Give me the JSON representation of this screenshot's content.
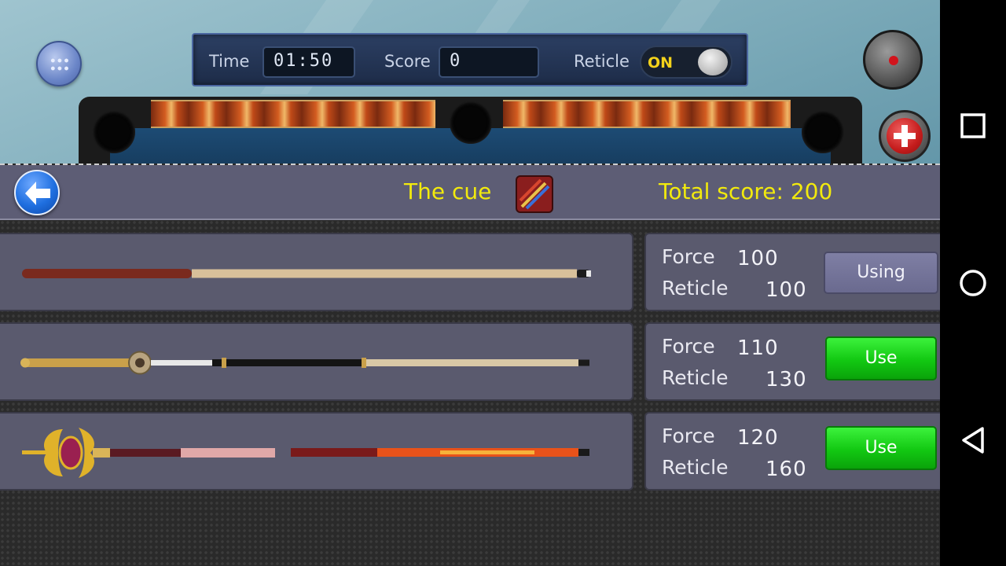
{
  "hud": {
    "time_label": "Time",
    "time_value": "01:50",
    "score_label": "Score",
    "score_value": "0",
    "reticle_label": "Reticle",
    "reticle_toggle": "ON"
  },
  "header": {
    "title": "The cue",
    "total_score": "Total score: 200"
  },
  "cues": [
    {
      "force_label": "Force",
      "force": "100",
      "reticle_label": "Reticle",
      "reticle": "100",
      "action": "Using"
    },
    {
      "force_label": "Force",
      "force": "110",
      "reticle_label": "Reticle",
      "reticle": "130",
      "action": "Use"
    },
    {
      "force_label": "Force",
      "force": "120",
      "reticle_label": "Reticle",
      "reticle": "160",
      "action": "Use"
    }
  ],
  "icons": {
    "menu": "grid-menu-icon",
    "record": "record-icon",
    "add": "plus-icon",
    "back": "back-arrow-icon",
    "cue_category": "cue-category-icon",
    "nav_recent": "square-icon",
    "nav_home": "circle-icon",
    "nav_back": "triangle-icon"
  },
  "colors": {
    "header_text": "#f2ea0d",
    "use_button": "#12c812",
    "using_button": "#6f6f94",
    "panel_bg": "#5a5a6e"
  }
}
